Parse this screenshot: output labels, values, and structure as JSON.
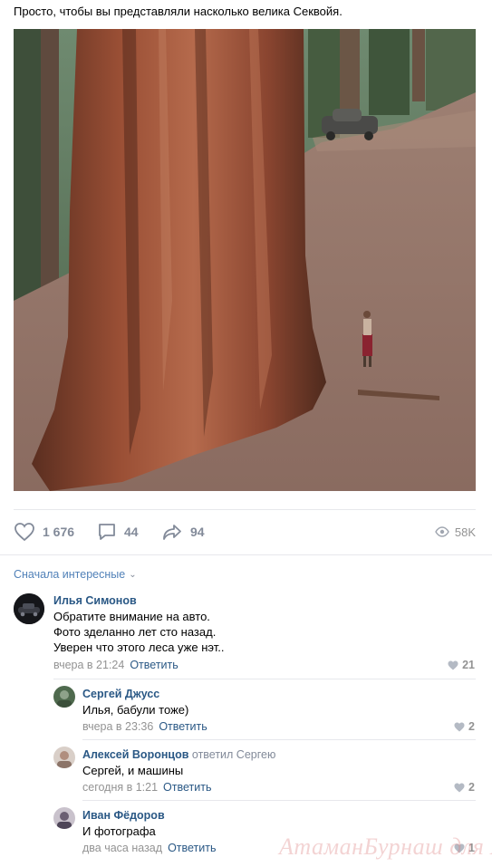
{
  "post": {
    "text": "Просто, чтобы вы представляли насколько велика Секвойя."
  },
  "actions": {
    "likes": "1 676",
    "comments": "44",
    "shares": "94",
    "views": "58K"
  },
  "comments_sort": {
    "label": "Сначала интересные",
    "chevron": "⌄"
  },
  "comments": [
    {
      "author": "Илья Симонов",
      "lines": [
        "Обратите внимание на авто.",
        "Фото зделанно лет сто назад.",
        "Уверен что этого леса уже нэт.."
      ],
      "time": "вчера в 21:24",
      "reply_label": "Ответить",
      "likes": "21"
    },
    {
      "author": "Сергей Джусс",
      "lines": [
        "Илья, бабули тоже)"
      ],
      "time": "вчера в 23:36",
      "reply_label": "Ответить",
      "likes": "2"
    },
    {
      "author": "Алексей Воронцов",
      "reply_to": "ответил Сергею",
      "lines": [
        "Сергей, и машины"
      ],
      "time": "сегодня в 1:21",
      "reply_label": "Ответить",
      "likes": "2"
    },
    {
      "author": "Иван Фёдоров",
      "lines": [
        "И фотографа"
      ],
      "time": "два часа назад",
      "reply_label": "Ответить",
      "likes": "1"
    }
  ],
  "watermark": "АтаманБурнаш для ЯП",
  "colors": {
    "link": "#2a5885",
    "accent": "#5181b8",
    "muted": "#939393",
    "icon": "#828a99"
  },
  "icons": {
    "like": "heart-icon",
    "comment": "comment-bubble-icon",
    "share": "share-arrow-icon",
    "views": "eye-icon"
  }
}
